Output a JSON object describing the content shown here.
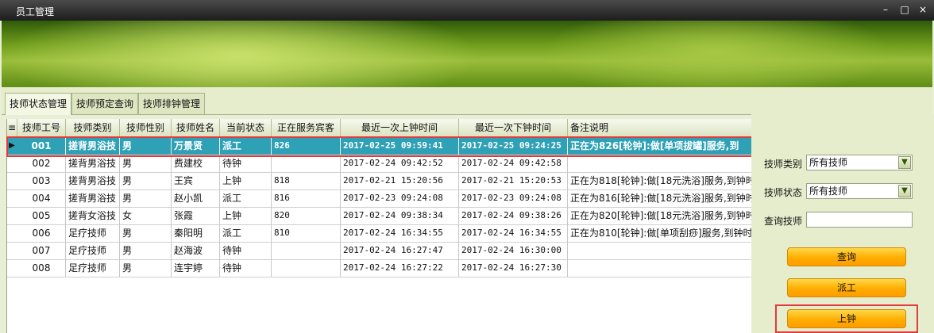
{
  "window": {
    "title": "员工管理",
    "minimize": "–",
    "maximize": "□",
    "close": "×"
  },
  "tabs": [
    "技师状态管理",
    "技师预定查询",
    "技师排钟管理"
  ],
  "table": {
    "columns": [
      "技师工号",
      "技师类别",
      "技师性别",
      "技师姓名",
      "当前状态",
      "正在服务宾客",
      "最近一次上钟时间",
      "最近一次下钟时间",
      "备注说明"
    ],
    "rows": [
      {
        "id": "001",
        "type": "搓背男浴技",
        "gender": "男",
        "name": "万景贤",
        "status": "派工",
        "guest": "826",
        "last_on": "2017-02-25 09:59:41",
        "last_off": "2017-02-25 09:24:25",
        "note": "正在为826[轮钟]:做[单项拔罐]服务,到"
      },
      {
        "id": "002",
        "type": "搓背男浴技",
        "gender": "男",
        "name": "费建校",
        "status": "待钟",
        "guest": "",
        "last_on": "2017-02-24 09:42:52",
        "last_off": "2017-02-24 09:42:58",
        "note": ""
      },
      {
        "id": "003",
        "type": "搓背男浴技",
        "gender": "男",
        "name": "王宾",
        "status": "上钟",
        "guest": "818",
        "last_on": "2017-02-21 15:20:56",
        "last_off": "2017-02-21 15:20:53",
        "note": "正在为818[轮钟]:做[18元洗浴]服务,到钟时"
      },
      {
        "id": "004",
        "type": "搓背男浴技",
        "gender": "男",
        "name": "赵小凯",
        "status": "派工",
        "guest": "816",
        "last_on": "2017-02-23 09:24:08",
        "last_off": "2017-02-23 09:24:08",
        "note": "正在为816[轮钟]:做[18元洗浴]服务,到钟时"
      },
      {
        "id": "005",
        "type": "搓背女浴技",
        "gender": "女",
        "name": "张霞",
        "status": "上钟",
        "guest": "820",
        "last_on": "2017-02-24 09:38:34",
        "last_off": "2017-02-24 09:38:26",
        "note": "正在为820[轮钟]:做[18元洗浴]服务,到钟时"
      },
      {
        "id": "006",
        "type": "足疗技师",
        "gender": "男",
        "name": "秦阳明",
        "status": "派工",
        "guest": "810",
        "last_on": "2017-02-24 16:34:55",
        "last_off": "2017-02-24 16:34:55",
        "note": "正在为810[轮钟]:做[单项刮痧]服务,到钟时"
      },
      {
        "id": "007",
        "type": "足疗技师",
        "gender": "男",
        "name": "赵海波",
        "status": "待钟",
        "guest": "",
        "last_on": "2017-02-24 16:27:47",
        "last_off": "2017-02-24 16:30:00",
        "note": ""
      },
      {
        "id": "008",
        "type": "足疗技师",
        "gender": "男",
        "name": "连宇婷",
        "status": "待钟",
        "guest": "",
        "last_on": "2017-02-24 16:27:22",
        "last_off": "2017-02-24 16:27:30",
        "note": ""
      }
    ]
  },
  "side": {
    "category_label": "技师类别",
    "category_value": "所有技师",
    "status_label": "技师状态",
    "status_value": "所有技师",
    "query_label": "查询技师",
    "query_value": "",
    "btn_query": "查询",
    "btn_dispatch": "派工",
    "btn_onclock": "上钟"
  }
}
